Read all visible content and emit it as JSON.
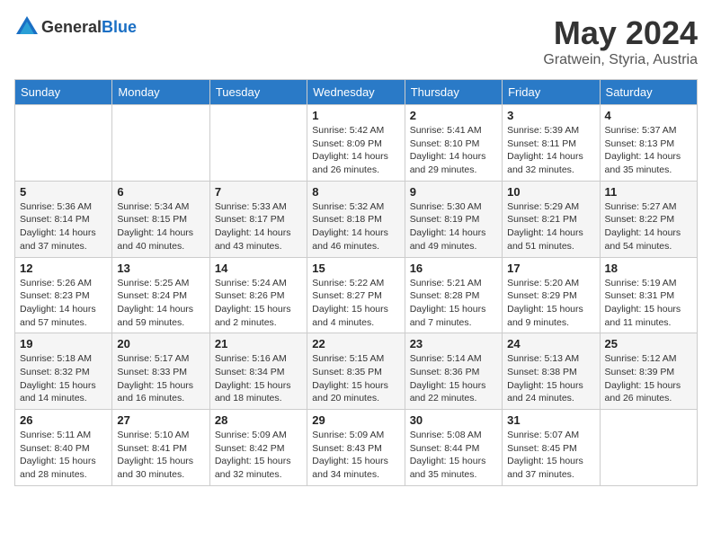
{
  "header": {
    "logo_general": "General",
    "logo_blue": "Blue",
    "month": "May 2024",
    "location": "Gratwein, Styria, Austria"
  },
  "weekdays": [
    "Sunday",
    "Monday",
    "Tuesday",
    "Wednesday",
    "Thursday",
    "Friday",
    "Saturday"
  ],
  "weeks": [
    [
      {
        "day": "",
        "sunrise": "",
        "sunset": "",
        "daylight": ""
      },
      {
        "day": "",
        "sunrise": "",
        "sunset": "",
        "daylight": ""
      },
      {
        "day": "",
        "sunrise": "",
        "sunset": "",
        "daylight": ""
      },
      {
        "day": "1",
        "sunrise": "Sunrise: 5:42 AM",
        "sunset": "Sunset: 8:09 PM",
        "daylight": "Daylight: 14 hours and 26 minutes."
      },
      {
        "day": "2",
        "sunrise": "Sunrise: 5:41 AM",
        "sunset": "Sunset: 8:10 PM",
        "daylight": "Daylight: 14 hours and 29 minutes."
      },
      {
        "day": "3",
        "sunrise": "Sunrise: 5:39 AM",
        "sunset": "Sunset: 8:11 PM",
        "daylight": "Daylight: 14 hours and 32 minutes."
      },
      {
        "day": "4",
        "sunrise": "Sunrise: 5:37 AM",
        "sunset": "Sunset: 8:13 PM",
        "daylight": "Daylight: 14 hours and 35 minutes."
      }
    ],
    [
      {
        "day": "5",
        "sunrise": "Sunrise: 5:36 AM",
        "sunset": "Sunset: 8:14 PM",
        "daylight": "Daylight: 14 hours and 37 minutes."
      },
      {
        "day": "6",
        "sunrise": "Sunrise: 5:34 AM",
        "sunset": "Sunset: 8:15 PM",
        "daylight": "Daylight: 14 hours and 40 minutes."
      },
      {
        "day": "7",
        "sunrise": "Sunrise: 5:33 AM",
        "sunset": "Sunset: 8:17 PM",
        "daylight": "Daylight: 14 hours and 43 minutes."
      },
      {
        "day": "8",
        "sunrise": "Sunrise: 5:32 AM",
        "sunset": "Sunset: 8:18 PM",
        "daylight": "Daylight: 14 hours and 46 minutes."
      },
      {
        "day": "9",
        "sunrise": "Sunrise: 5:30 AM",
        "sunset": "Sunset: 8:19 PM",
        "daylight": "Daylight: 14 hours and 49 minutes."
      },
      {
        "day": "10",
        "sunrise": "Sunrise: 5:29 AM",
        "sunset": "Sunset: 8:21 PM",
        "daylight": "Daylight: 14 hours and 51 minutes."
      },
      {
        "day": "11",
        "sunrise": "Sunrise: 5:27 AM",
        "sunset": "Sunset: 8:22 PM",
        "daylight": "Daylight: 14 hours and 54 minutes."
      }
    ],
    [
      {
        "day": "12",
        "sunrise": "Sunrise: 5:26 AM",
        "sunset": "Sunset: 8:23 PM",
        "daylight": "Daylight: 14 hours and 57 minutes."
      },
      {
        "day": "13",
        "sunrise": "Sunrise: 5:25 AM",
        "sunset": "Sunset: 8:24 PM",
        "daylight": "Daylight: 14 hours and 59 minutes."
      },
      {
        "day": "14",
        "sunrise": "Sunrise: 5:24 AM",
        "sunset": "Sunset: 8:26 PM",
        "daylight": "Daylight: 15 hours and 2 minutes."
      },
      {
        "day": "15",
        "sunrise": "Sunrise: 5:22 AM",
        "sunset": "Sunset: 8:27 PM",
        "daylight": "Daylight: 15 hours and 4 minutes."
      },
      {
        "day": "16",
        "sunrise": "Sunrise: 5:21 AM",
        "sunset": "Sunset: 8:28 PM",
        "daylight": "Daylight: 15 hours and 7 minutes."
      },
      {
        "day": "17",
        "sunrise": "Sunrise: 5:20 AM",
        "sunset": "Sunset: 8:29 PM",
        "daylight": "Daylight: 15 hours and 9 minutes."
      },
      {
        "day": "18",
        "sunrise": "Sunrise: 5:19 AM",
        "sunset": "Sunset: 8:31 PM",
        "daylight": "Daylight: 15 hours and 11 minutes."
      }
    ],
    [
      {
        "day": "19",
        "sunrise": "Sunrise: 5:18 AM",
        "sunset": "Sunset: 8:32 PM",
        "daylight": "Daylight: 15 hours and 14 minutes."
      },
      {
        "day": "20",
        "sunrise": "Sunrise: 5:17 AM",
        "sunset": "Sunset: 8:33 PM",
        "daylight": "Daylight: 15 hours and 16 minutes."
      },
      {
        "day": "21",
        "sunrise": "Sunrise: 5:16 AM",
        "sunset": "Sunset: 8:34 PM",
        "daylight": "Daylight: 15 hours and 18 minutes."
      },
      {
        "day": "22",
        "sunrise": "Sunrise: 5:15 AM",
        "sunset": "Sunset: 8:35 PM",
        "daylight": "Daylight: 15 hours and 20 minutes."
      },
      {
        "day": "23",
        "sunrise": "Sunrise: 5:14 AM",
        "sunset": "Sunset: 8:36 PM",
        "daylight": "Daylight: 15 hours and 22 minutes."
      },
      {
        "day": "24",
        "sunrise": "Sunrise: 5:13 AM",
        "sunset": "Sunset: 8:38 PM",
        "daylight": "Daylight: 15 hours and 24 minutes."
      },
      {
        "day": "25",
        "sunrise": "Sunrise: 5:12 AM",
        "sunset": "Sunset: 8:39 PM",
        "daylight": "Daylight: 15 hours and 26 minutes."
      }
    ],
    [
      {
        "day": "26",
        "sunrise": "Sunrise: 5:11 AM",
        "sunset": "Sunset: 8:40 PM",
        "daylight": "Daylight: 15 hours and 28 minutes."
      },
      {
        "day": "27",
        "sunrise": "Sunrise: 5:10 AM",
        "sunset": "Sunset: 8:41 PM",
        "daylight": "Daylight: 15 hours and 30 minutes."
      },
      {
        "day": "28",
        "sunrise": "Sunrise: 5:09 AM",
        "sunset": "Sunset: 8:42 PM",
        "daylight": "Daylight: 15 hours and 32 minutes."
      },
      {
        "day": "29",
        "sunrise": "Sunrise: 5:09 AM",
        "sunset": "Sunset: 8:43 PM",
        "daylight": "Daylight: 15 hours and 34 minutes."
      },
      {
        "day": "30",
        "sunrise": "Sunrise: 5:08 AM",
        "sunset": "Sunset: 8:44 PM",
        "daylight": "Daylight: 15 hours and 35 minutes."
      },
      {
        "day": "31",
        "sunrise": "Sunrise: 5:07 AM",
        "sunset": "Sunset: 8:45 PM",
        "daylight": "Daylight: 15 hours and 37 minutes."
      },
      {
        "day": "",
        "sunrise": "",
        "sunset": "",
        "daylight": ""
      }
    ]
  ]
}
